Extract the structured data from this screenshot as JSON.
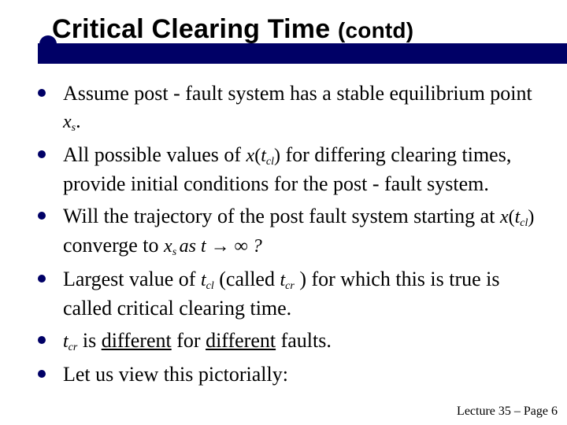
{
  "title": {
    "main": "Critical Clearing Time ",
    "sub": "(contd)"
  },
  "bullets": {
    "b1": {
      "t1": "Assume post - fault system has a stable equilibrium point ",
      "m1": "x",
      "m1sub": "s",
      "t2": "."
    },
    "b2": {
      "t1": "All possible values of ",
      "m1": "x",
      "m1p": "(",
      "m1v": "t",
      "m1sub": "cl",
      "m1cp": ")",
      "t2": " for differing clearing times, provide initial conditions for the post - fault system."
    },
    "b3": {
      "t1": "Will the trajectory of the post fault system starting at ",
      "m1": "x",
      "m1p": "(",
      "m1v": "t",
      "m1sub": "cl",
      "m1cp": ")",
      "t2": " converge to ",
      "m2": "x",
      "m2sub": "s ",
      "m2as": " as  t → ∞ ?"
    },
    "b4": {
      "t1": "Largest value of ",
      "m1": "t",
      "m1sub": "cl",
      "t2": " (called ",
      "m2": "t",
      "m2sub": "cr",
      "t3": " ) for which this is true is called critical clearing time."
    },
    "b5": {
      "m1": "t",
      "m1sub": "cr",
      "t1": " is ",
      "u1": "different",
      "t2": " for ",
      "u2": "different",
      "t3": " faults."
    },
    "b6": {
      "t1": "Let us view this pictorially:"
    }
  },
  "footer": "Lecture 35 – Page 6"
}
